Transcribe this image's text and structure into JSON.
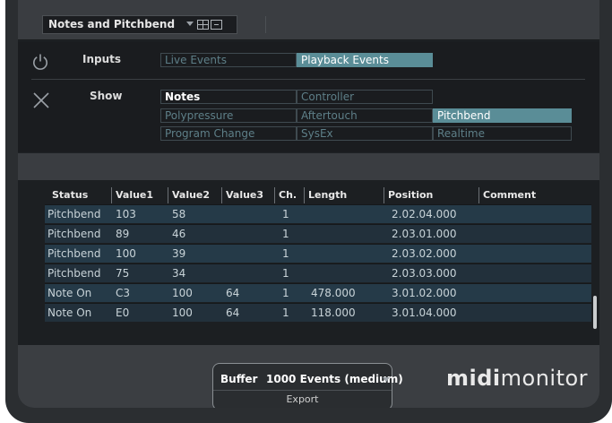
{
  "preset": {
    "name": "Notes and Pitchbend"
  },
  "filters": {
    "inputs_label": "Inputs",
    "show_label": "Show",
    "input_buttons": [
      {
        "label": "Live Events",
        "active": false
      },
      {
        "label": "Playback Events",
        "active": true
      }
    ],
    "show_buttons": [
      {
        "label": "Notes",
        "active": false,
        "highlight": true
      },
      {
        "label": "Controller",
        "active": false
      },
      {
        "label": "Polypressure",
        "active": false
      },
      {
        "label": "Aftertouch",
        "active": false
      },
      {
        "label": "Pitchbend",
        "active": true
      },
      {
        "label": "Program Change",
        "active": false
      },
      {
        "label": "SysEx",
        "active": false
      },
      {
        "label": "Realtime",
        "active": false
      }
    ]
  },
  "table": {
    "columns": [
      "Status",
      "Value1",
      "Value2",
      "Value3",
      "Ch.",
      "Length",
      "Position",
      "Comment"
    ],
    "rows": [
      {
        "status": "Pitchbend",
        "v1": "103",
        "v2": "58",
        "v3": "",
        "ch": "1",
        "length": "",
        "position": "2.02.04.000",
        "comment": ""
      },
      {
        "status": "Pitchbend",
        "v1": "89",
        "v2": "46",
        "v3": "",
        "ch": "1",
        "length": "",
        "position": "2.03.01.000",
        "comment": ""
      },
      {
        "status": "Pitchbend",
        "v1": "100",
        "v2": "39",
        "v3": "",
        "ch": "1",
        "length": "",
        "position": "2.03.02.000",
        "comment": ""
      },
      {
        "status": "Pitchbend",
        "v1": "75",
        "v2": "34",
        "v3": "",
        "ch": "1",
        "length": "",
        "position": "2.03.03.000",
        "comment": ""
      },
      {
        "status": "Note On",
        "v1": "C3",
        "v2": "100",
        "v3": "64",
        "ch": "1",
        "length": "478.000",
        "position": "3.01.02.000",
        "comment": ""
      },
      {
        "status": "Note On",
        "v1": "E0",
        "v2": "100",
        "v3": "64",
        "ch": "1",
        "length": "118.000",
        "position": "3.01.04.000",
        "comment": ""
      }
    ]
  },
  "buffer": {
    "label": "Buffer",
    "value": "1000 Events (medium)",
    "export_label": "Export"
  },
  "logo": {
    "bold": "midi",
    "light": "monitor"
  },
  "colors": {
    "active_button": "#5a8d97",
    "row_even": "#253a48",
    "row_odd": "#22303b"
  }
}
